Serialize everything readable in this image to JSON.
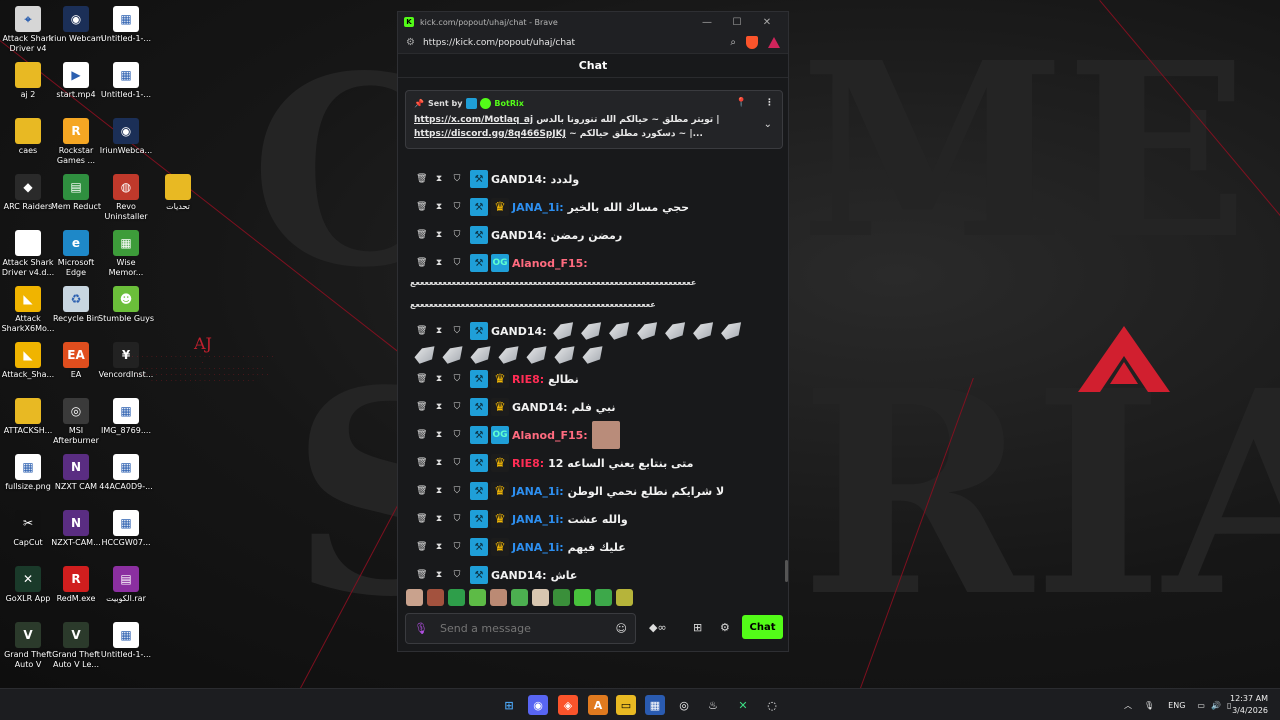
{
  "desktop": {
    "icons": [
      {
        "label": "Attack Shark Driver v4",
        "color": "#d6d6d6",
        "glyph": "⌖"
      },
      {
        "label": "Iriun Webcam",
        "color": "#1b2f57",
        "glyph": "◉"
      },
      {
        "label": "Untitled-1-...",
        "color": "#ffffff",
        "glyph": "▦"
      },
      {
        "label": "aj 2",
        "color": "#e8b923",
        "glyph": ""
      },
      {
        "label": "start.mp4",
        "color": "#ffffff",
        "glyph": "▶"
      },
      {
        "label": "Untitled-1-...",
        "color": "#ffffff",
        "glyph": "▦"
      },
      {
        "label": "caes",
        "color": "#e8b923",
        "glyph": ""
      },
      {
        "label": "Rockstar Games ...",
        "color": "#f5a623",
        "glyph": "R"
      },
      {
        "label": "IriunWebca...",
        "color": "#1b2f57",
        "glyph": "◉"
      },
      {
        "label": "ARC Raiders",
        "color": "#2a2a2a",
        "glyph": "◆"
      },
      {
        "label": "Mem Reduct",
        "color": "#2f8f3f",
        "glyph": "▤"
      },
      {
        "label": "Revo Uninstaller",
        "color": "#c0392b",
        "glyph": "◍"
      },
      {
        "label": "تحديات",
        "color": "#e8b923",
        "glyph": ""
      },
      {
        "label": "Attack Shark Driver v4.d...",
        "color": "#ffffff",
        "glyph": ""
      },
      {
        "label": "Microsoft Edge",
        "color": "#1e88c8",
        "glyph": "e"
      },
      {
        "label": "Wise Memor...",
        "color": "#3d9c3a",
        "glyph": "▦"
      },
      {
        "label": "Attack SharkX6Mo...",
        "color": "#f0b400",
        "glyph": "◣"
      },
      {
        "label": "Recycle Bin",
        "color": "#c8d6e0",
        "glyph": "♻"
      },
      {
        "label": "Stumble Guys",
        "color": "#6bbf3a",
        "glyph": "☻"
      },
      {
        "label": "Attack_Sha...",
        "color": "#f0b400",
        "glyph": "◣"
      },
      {
        "label": "EA",
        "color": "#e04e1e",
        "glyph": "EA"
      },
      {
        "label": "VencordInst...",
        "color": "#222222",
        "glyph": "¥"
      },
      {
        "label": "ATTACKSH...",
        "color": "#e8b923",
        "glyph": ""
      },
      {
        "label": "MSI Afterburner",
        "color": "#3a3a3a",
        "glyph": "◎"
      },
      {
        "label": "IMG_8769....",
        "color": "#ffffff",
        "glyph": "▦"
      },
      {
        "label": "fullsize.png",
        "color": "#ffffff",
        "glyph": "▦"
      },
      {
        "label": "NZXT CAM",
        "color": "#5a2d82",
        "glyph": "N"
      },
      {
        "label": "44ACA0D9-...",
        "color": "#ffffff",
        "glyph": "▦"
      },
      {
        "label": "CapCut",
        "color": "#111111",
        "glyph": "✂"
      },
      {
        "label": "NZXT-CAM...",
        "color": "#5a2d82",
        "glyph": "N"
      },
      {
        "label": "HCCGW07...",
        "color": "#ffffff",
        "glyph": "▦"
      },
      {
        "label": "GoXLR App",
        "color": "#1a3a2a",
        "glyph": "✕"
      },
      {
        "label": "RedM.exe",
        "color": "#d01e1e",
        "glyph": "R"
      },
      {
        "label": "الكوبيت.rar",
        "color": "#8b2fa0",
        "glyph": "▤"
      },
      {
        "label": "Grand Theft Auto V",
        "color": "#2b3a2b",
        "glyph": "V"
      },
      {
        "label": "Grand Theft Auto V Le...",
        "color": "#2b3a2b",
        "glyph": "V"
      },
      {
        "label": "Untitled-1-...",
        "color": "#ffffff",
        "glyph": "▦"
      }
    ],
    "aj_logo_text": "AJ"
  },
  "browser": {
    "title": "kick.com/popout/uhaj/chat - Brave",
    "favicon": "K",
    "url": "https://kick.com/popout/uhaj/chat",
    "min": "—",
    "max": "☐",
    "close": "✕"
  },
  "chat": {
    "header": "Chat",
    "pinned": {
      "sent_by": "Sent by",
      "bot_name": "BotRix",
      "line1_link": "https://x.com/Motlaq_aj",
      "line1_text": "تويتر مطلق ~ حيالكم الله تنورونا بالدس |",
      "line2_link": "https://discord.gg/8q466SpJKJ",
      "line2_text": "~ دسكورد مطلق حيالكم ~ |..."
    },
    "messages": [
      {
        "user": "GAND14:",
        "color": "#f2f2f2",
        "badges": [
          "mod"
        ],
        "text": "ولددد"
      },
      {
        "user": "JANA_1i:",
        "color": "#2d8ff0",
        "badges": [
          "mod",
          "crown"
        ],
        "text": "حجي مساك الله بالخير"
      },
      {
        "user": "GAND14:",
        "color": "#f2f2f2",
        "badges": [
          "mod"
        ],
        "text": "رمضن رمضن"
      },
      {
        "user": "Alanod_F15:",
        "color": "#ff6b7f",
        "badges": [
          "mod",
          "og"
        ],
        "text": ""
      },
      {
        "user": "GAND14:",
        "color": "#f2f2f2",
        "badges": [
          "mod"
        ],
        "text": ""
      },
      {
        "user": "RIE8:",
        "color": "#ff2d55",
        "badges": [
          "mod",
          "crown"
        ],
        "text": "نطالع"
      },
      {
        "user": "GAND14:",
        "color": "#f2f2f2",
        "badges": [
          "mod",
          "crown"
        ],
        "text": "نبي فلم"
      },
      {
        "user": "Alanod_F15:",
        "color": "#ff6b7f",
        "badges": [
          "mod",
          "og"
        ],
        "text": ""
      },
      {
        "user": "RIE8:",
        "color": "#ff2d55",
        "badges": [
          "mod",
          "crown"
        ],
        "text": "متى بنتابع يعني الساعه 12"
      },
      {
        "user": "JANA_1i:",
        "color": "#2d8ff0",
        "badges": [
          "mod",
          "crown"
        ],
        "text": "لا شرايكم نطلع نحمي الوطن"
      },
      {
        "user": "JANA_1i:",
        "color": "#2d8ff0",
        "badges": [
          "mod",
          "crown"
        ],
        "text": "والله عشت"
      },
      {
        "user": "JANA_1i:",
        "color": "#2d8ff0",
        "badges": [
          "mod",
          "crown"
        ],
        "text": "عليك فيهم"
      },
      {
        "user": "GAND14:",
        "color": "#f2f2f2",
        "badges": [
          "mod"
        ],
        "text": "عاش"
      }
    ],
    "long_line_1": "ععععععععععععععععععععععععععععععععععععععععععععععععععععععععععععععع",
    "long_line_2": "عععععععععععععععععععععععععععععععععععععععععععععععععععععع",
    "composer_placeholder": "Send a message",
    "send_label": "Chat"
  },
  "taskbar": {
    "lang": "ENG",
    "time": "12:37 AM",
    "date": "3/4/2026"
  },
  "colors": {
    "kick_green": "#53fc18",
    "accent_red": "#c0202e"
  }
}
